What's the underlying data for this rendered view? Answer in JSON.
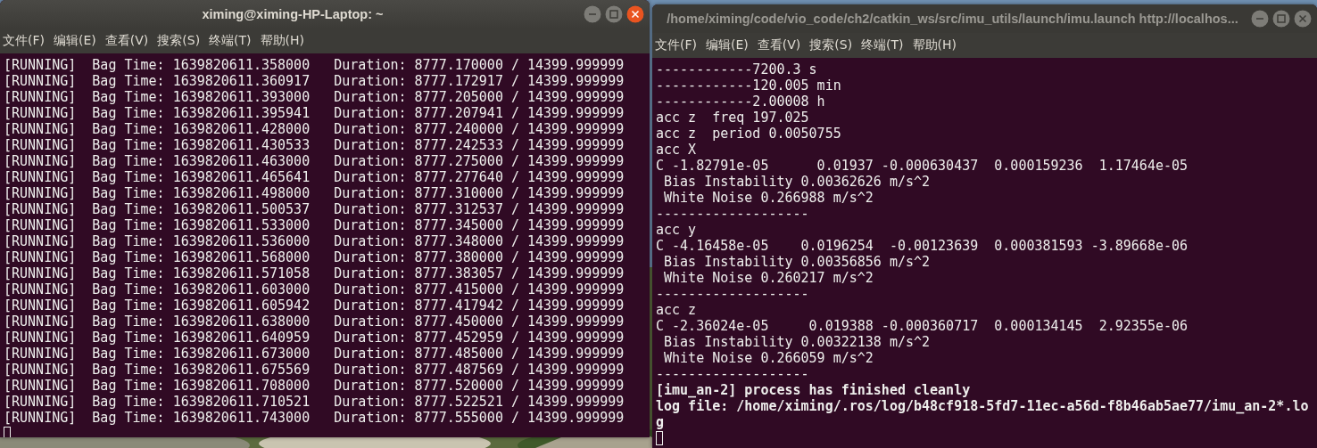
{
  "windows": [
    {
      "title": "ximing@ximing-HP-Laptop: ~",
      "focused": true,
      "menu": [
        "文件(F)",
        "编辑(E)",
        "查看(V)",
        "搜索(S)",
        "终端(T)",
        "帮助(H)"
      ],
      "lines": [
        {
          "text": "[RUNNING]  Bag Time: 1639820611.358000   Duration: 8777.170000 / 14399.999999",
          "bold": false
        },
        {
          "text": "[RUNNING]  Bag Time: 1639820611.360917   Duration: 8777.172917 / 14399.999999",
          "bold": false
        },
        {
          "text": "[RUNNING]  Bag Time: 1639820611.393000   Duration: 8777.205000 / 14399.999999",
          "bold": false
        },
        {
          "text": "[RUNNING]  Bag Time: 1639820611.395941   Duration: 8777.207941 / 14399.999999",
          "bold": false
        },
        {
          "text": "[RUNNING]  Bag Time: 1639820611.428000   Duration: 8777.240000 / 14399.999999",
          "bold": false
        },
        {
          "text": "[RUNNING]  Bag Time: 1639820611.430533   Duration: 8777.242533 / 14399.999999",
          "bold": false
        },
        {
          "text": "[RUNNING]  Bag Time: 1639820611.463000   Duration: 8777.275000 / 14399.999999",
          "bold": false
        },
        {
          "text": "[RUNNING]  Bag Time: 1639820611.465641   Duration: 8777.277640 / 14399.999999",
          "bold": false
        },
        {
          "text": "[RUNNING]  Bag Time: 1639820611.498000   Duration: 8777.310000 / 14399.999999",
          "bold": false
        },
        {
          "text": "[RUNNING]  Bag Time: 1639820611.500537   Duration: 8777.312537 / 14399.999999",
          "bold": false
        },
        {
          "text": "[RUNNING]  Bag Time: 1639820611.533000   Duration: 8777.345000 / 14399.999999",
          "bold": false
        },
        {
          "text": "[RUNNING]  Bag Time: 1639820611.536000   Duration: 8777.348000 / 14399.999999",
          "bold": false
        },
        {
          "text": "[RUNNING]  Bag Time: 1639820611.568000   Duration: 8777.380000 / 14399.999999",
          "bold": false
        },
        {
          "text": "[RUNNING]  Bag Time: 1639820611.571058   Duration: 8777.383057 / 14399.999999",
          "bold": false
        },
        {
          "text": "[RUNNING]  Bag Time: 1639820611.603000   Duration: 8777.415000 / 14399.999999",
          "bold": false
        },
        {
          "text": "[RUNNING]  Bag Time: 1639820611.605942   Duration: 8777.417942 / 14399.999999",
          "bold": false
        },
        {
          "text": "[RUNNING]  Bag Time: 1639820611.638000   Duration: 8777.450000 / 14399.999999",
          "bold": false
        },
        {
          "text": "[RUNNING]  Bag Time: 1639820611.640959   Duration: 8777.452959 / 14399.999999",
          "bold": false
        },
        {
          "text": "[RUNNING]  Bag Time: 1639820611.673000   Duration: 8777.485000 / 14399.999999",
          "bold": false
        },
        {
          "text": "[RUNNING]  Bag Time: 1639820611.675569   Duration: 8777.487569 / 14399.999999",
          "bold": false
        },
        {
          "text": "[RUNNING]  Bag Time: 1639820611.708000   Duration: 8777.520000 / 14399.999999",
          "bold": false
        },
        {
          "text": "[RUNNING]  Bag Time: 1639820611.710521   Duration: 8777.522521 / 14399.999999",
          "bold": false
        },
        {
          "text": "[RUNNING]  Bag Time: 1639820611.743000   Duration: 8777.555000 / 14399.999999",
          "bold": false
        }
      ]
    },
    {
      "title": "/home/ximing/code/vio_code/ch2/catkin_ws/src/imu_utils/launch/imu.launch http://localhos...",
      "focused": false,
      "menu": [
        "文件(F)",
        "编辑(E)",
        "查看(V)",
        "搜索(S)",
        "终端(T)",
        "帮助(H)"
      ],
      "lines": [
        {
          "text": "------------7200.3 s",
          "bold": false
        },
        {
          "text": "------------120.005 min",
          "bold": false
        },
        {
          "text": "------------2.00008 h",
          "bold": false
        },
        {
          "text": "acc z  freq 197.025",
          "bold": false
        },
        {
          "text": "acc z  period 0.0050755",
          "bold": false
        },
        {
          "text": "acc X",
          "bold": false
        },
        {
          "text": "C -1.82791e-05      0.01937 -0.000630437  0.000159236  1.17464e-05",
          "bold": false
        },
        {
          "text": " Bias Instability 0.00362626 m/s^2",
          "bold": false
        },
        {
          "text": " White Noise 0.266988 m/s^2",
          "bold": false
        },
        {
          "text": "-------------------",
          "bold": false
        },
        {
          "text": "acc y",
          "bold": false
        },
        {
          "text": "C -4.16458e-05    0.0196254  -0.00123639  0.000381593 -3.89668e-06",
          "bold": false
        },
        {
          "text": " Bias Instability 0.00356856 m/s^2",
          "bold": false
        },
        {
          "text": " White Noise 0.260217 m/s^2",
          "bold": false
        },
        {
          "text": "-------------------",
          "bold": false
        },
        {
          "text": "acc z",
          "bold": false
        },
        {
          "text": "C -2.36024e-05     0.019388 -0.000360717  0.000134145  2.92355e-06",
          "bold": false
        },
        {
          "text": " Bias Instability 0.00322138 m/s^2",
          "bold": false
        },
        {
          "text": " White Noise 0.266059 m/s^2",
          "bold": false
        },
        {
          "text": "-------------------",
          "bold": false
        },
        {
          "text": "[imu_an-2] process has finished cleanly",
          "bold": true
        },
        {
          "text": "log file: /home/ximing/.ros/log/b48cf918-5fd7-11ec-a56d-f8b46ab5ae77/imu_an-2*.log",
          "bold": true
        }
      ]
    }
  ]
}
